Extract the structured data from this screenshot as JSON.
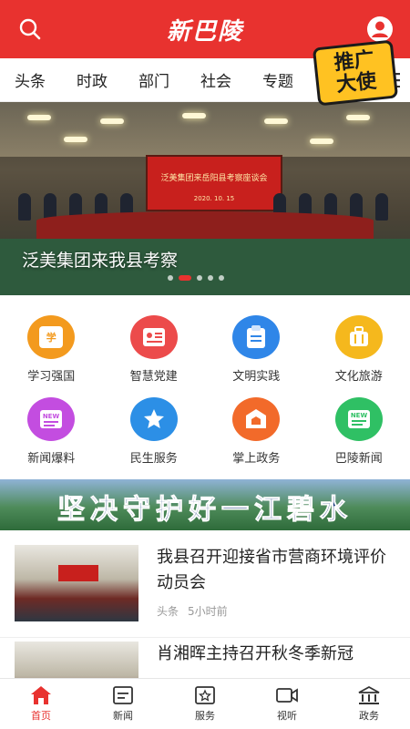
{
  "header": {
    "logo": "新巴陵",
    "search_icon": "search-icon",
    "user_icon": "user-icon",
    "brand_color": "#e8322f"
  },
  "tabs": {
    "items": [
      "头条",
      "时政",
      "部门",
      "社会",
      "专题",
      "乡镇"
    ],
    "menu_icon": "menu-icon"
  },
  "banner": {
    "caption": "泛美集团来我县考察",
    "screen_title": "泛美集团来岳阳县考察座谈会",
    "screen_date": "2020. 10. 15",
    "slide_count": 5,
    "active_slide": 2
  },
  "grid": {
    "items": [
      {
        "label": "学习强国",
        "icon": "study-icon",
        "color": "#f39a1e"
      },
      {
        "label": "智慧党建",
        "icon": "party-icon",
        "color": "#ec4b4b"
      },
      {
        "label": "文明实践",
        "icon": "clipboard-icon",
        "color": "#2f86e8"
      },
      {
        "label": "文化旅游",
        "icon": "luggage-icon",
        "color": "#f5b81d"
      },
      {
        "label": "新闻爆料",
        "icon": "news-icon",
        "color": "#c34de0"
      },
      {
        "label": "民生服务",
        "icon": "star-icon",
        "color": "#2c8fe6"
      },
      {
        "label": "掌上政务",
        "icon": "government-icon",
        "color": "#f26a2a"
      },
      {
        "label": "巴陵新闻",
        "icon": "news-new-icon",
        "color": "#2fc064"
      }
    ]
  },
  "slogan": {
    "text": "坚决守护好一江碧水"
  },
  "news": {
    "items": [
      {
        "title": "我县召开迎接省市营商环境评价动员会",
        "category": "头条",
        "time": "5小时前"
      },
      {
        "title": "肖湘晖主持召开秋冬季新冠",
        "category": "",
        "time": ""
      }
    ]
  },
  "badge": {
    "text_top": "推广",
    "text_bottom": "大使"
  },
  "bottom_nav": {
    "items": [
      {
        "label": "首页",
        "icon": "home-icon",
        "active": true
      },
      {
        "label": "新闻",
        "icon": "news-list-icon",
        "active": false
      },
      {
        "label": "服务",
        "icon": "service-icon",
        "active": false
      },
      {
        "label": "视听",
        "icon": "video-icon",
        "active": false
      },
      {
        "label": "政务",
        "icon": "govt-building-icon",
        "active": false
      }
    ]
  }
}
